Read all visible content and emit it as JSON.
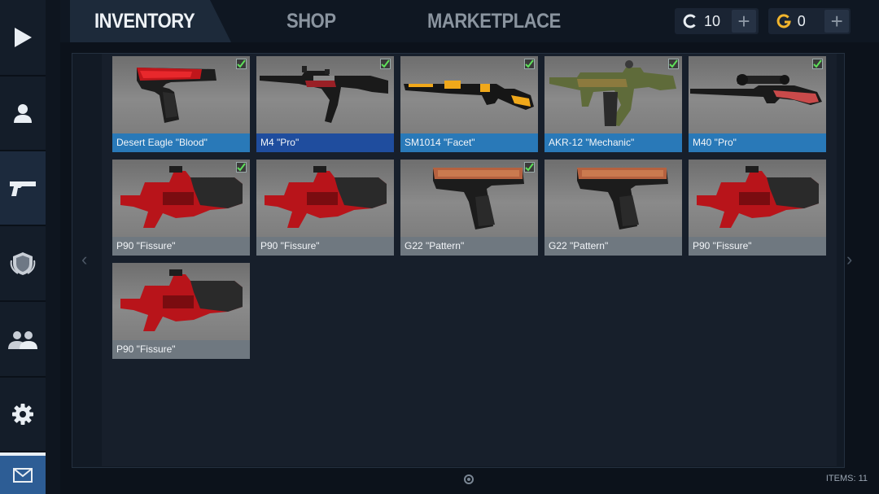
{
  "tabs": {
    "inventory": "INVENTORY",
    "shop": "SHOP",
    "marketplace": "MARKETPLACE"
  },
  "currencies": [
    {
      "icon": "credits-icon",
      "value": "10"
    },
    {
      "icon": "gold-icon",
      "value": "0"
    }
  ],
  "sidebar": [
    "play-icon",
    "profile-icon",
    "weapons-icon",
    "clan-shield-icon",
    "friends-icon",
    "settings-icon",
    "mail-icon"
  ],
  "items": [
    {
      "name": "Desert Eagle \"Blood\"",
      "equipped": true,
      "label_style": "blue",
      "weapon": "pistol-red"
    },
    {
      "name": "M4 \"Pro\"",
      "equipped": true,
      "label_style": "darkblue",
      "weapon": "rifle-black"
    },
    {
      "name": "SM1014 \"Facet\"",
      "equipped": true,
      "label_style": "blue",
      "weapon": "shotgun-yellow"
    },
    {
      "name": "AKR-12 \"Mechanic\"",
      "equipped": true,
      "label_style": "blue",
      "weapon": "rifle-olive"
    },
    {
      "name": "M40 \"Pro\"",
      "equipped": true,
      "label_style": "blue",
      "weapon": "sniper"
    },
    {
      "name": "P90 \"Fissure\"",
      "equipped": true,
      "label_style": "gray",
      "weapon": "p90"
    },
    {
      "name": "P90 \"Fissure\"",
      "equipped": false,
      "label_style": "gray",
      "weapon": "p90"
    },
    {
      "name": "G22 \"Pattern\"",
      "equipped": true,
      "label_style": "gray",
      "weapon": "glock"
    },
    {
      "name": "G22 \"Pattern\"",
      "equipped": false,
      "label_style": "gray",
      "weapon": "glock"
    },
    {
      "name": "P90 \"Fissure\"",
      "equipped": false,
      "label_style": "gray",
      "weapon": "p90"
    },
    {
      "name": "P90 \"Fissure\"",
      "equipped": false,
      "label_style": "gray",
      "weapon": "p90"
    }
  ],
  "footer": {
    "items_count": "ITEMS: 11"
  },
  "nav": {
    "prev": "‹",
    "next": "›"
  }
}
